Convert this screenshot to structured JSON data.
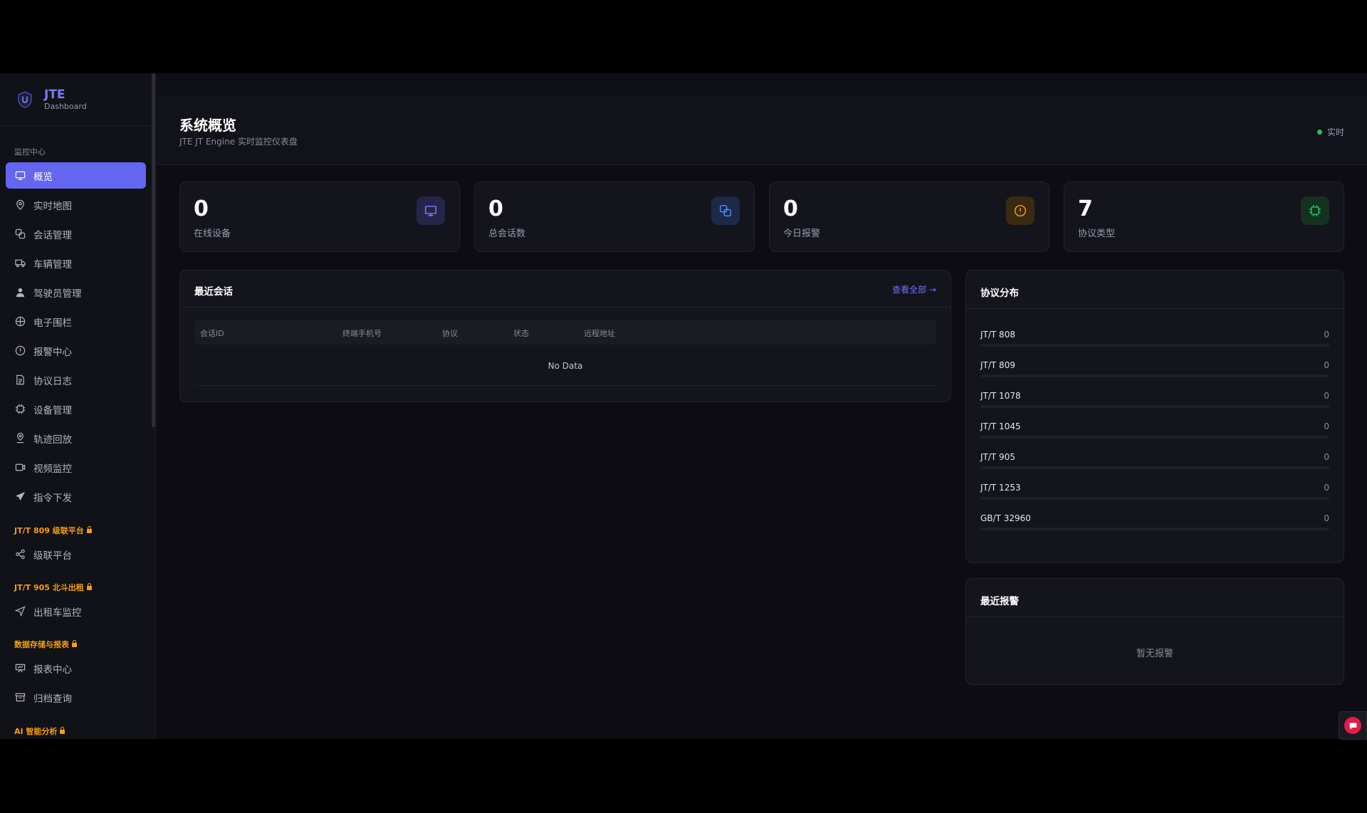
{
  "brand": {
    "title": "JTE",
    "subtitle": "Dashboard"
  },
  "sidebar": {
    "groups": {
      "monitor": "监控中心",
      "jt809": "JT/T 809 级联平台",
      "jt905": "JT/T 905 北斗出租",
      "storage": "数据存储与报表",
      "ai": "AI 智能分析"
    },
    "items": [
      {
        "label": "概览",
        "icon": "monitor-icon"
      },
      {
        "label": "实时地图",
        "icon": "map-pin-icon"
      },
      {
        "label": "会话管理",
        "icon": "sessions-icon"
      },
      {
        "label": "车辆管理",
        "icon": "truck-icon"
      },
      {
        "label": "驾驶员管理",
        "icon": "user-icon"
      },
      {
        "label": "电子围栏",
        "icon": "fence-icon"
      },
      {
        "label": "报警中心",
        "icon": "alert-icon"
      },
      {
        "label": "协议日志",
        "icon": "document-icon"
      },
      {
        "label": "设备管理",
        "icon": "chip-icon"
      },
      {
        "label": "轨迹回放",
        "icon": "track-icon"
      },
      {
        "label": "视频监控",
        "icon": "video-icon"
      },
      {
        "label": "指令下发",
        "icon": "send-icon"
      },
      {
        "label": "级联平台",
        "icon": "share-icon"
      },
      {
        "label": "出租车监控",
        "icon": "navigation-icon"
      },
      {
        "label": "报表中心",
        "icon": "chart-icon"
      },
      {
        "label": "归档查询",
        "icon": "archive-icon"
      }
    ]
  },
  "header": {
    "title": "系统概览",
    "subtitle": "JTE JT Engine 实时监控仪表盘",
    "live_label": "实时",
    "live_color": "#22c55e"
  },
  "stats": [
    {
      "value": "0",
      "label": "在线设备",
      "icon": "monitor-icon",
      "color": "#6366f1"
    },
    {
      "value": "0",
      "label": "总会话数",
      "icon": "link-icon",
      "color": "#3b82f6"
    },
    {
      "value": "0",
      "label": "今日报警",
      "icon": "alert-icon",
      "color": "#f59e0b"
    },
    {
      "value": "7",
      "label": "协议类型",
      "icon": "chip-icon",
      "color": "#22c55e"
    }
  ],
  "recent_sessions": {
    "title": "最近会话",
    "view_all": "查看全部 →",
    "columns": [
      "会话ID",
      "终端手机号",
      "协议",
      "状态",
      "远程地址"
    ],
    "empty": "No Data"
  },
  "protocols": {
    "title": "协议分布",
    "items": [
      {
        "name": "JT/T 808",
        "count": "0",
        "fraction": 0
      },
      {
        "name": "JT/T 809",
        "count": "0",
        "fraction": 0
      },
      {
        "name": "JT/T 1078",
        "count": "0",
        "fraction": 0
      },
      {
        "name": "JT/T 1045",
        "count": "0",
        "fraction": 0
      },
      {
        "name": "JT/T 905",
        "count": "0",
        "fraction": 0
      },
      {
        "name": "JT/T 1253",
        "count": "0",
        "fraction": 0
      },
      {
        "name": "GB/T 32960",
        "count": "0",
        "fraction": 0
      }
    ]
  },
  "recent_alarms": {
    "title": "最近报警",
    "empty": "暂无报警"
  },
  "accent_color": "#6366f1",
  "pro_color": "#f59e0b"
}
